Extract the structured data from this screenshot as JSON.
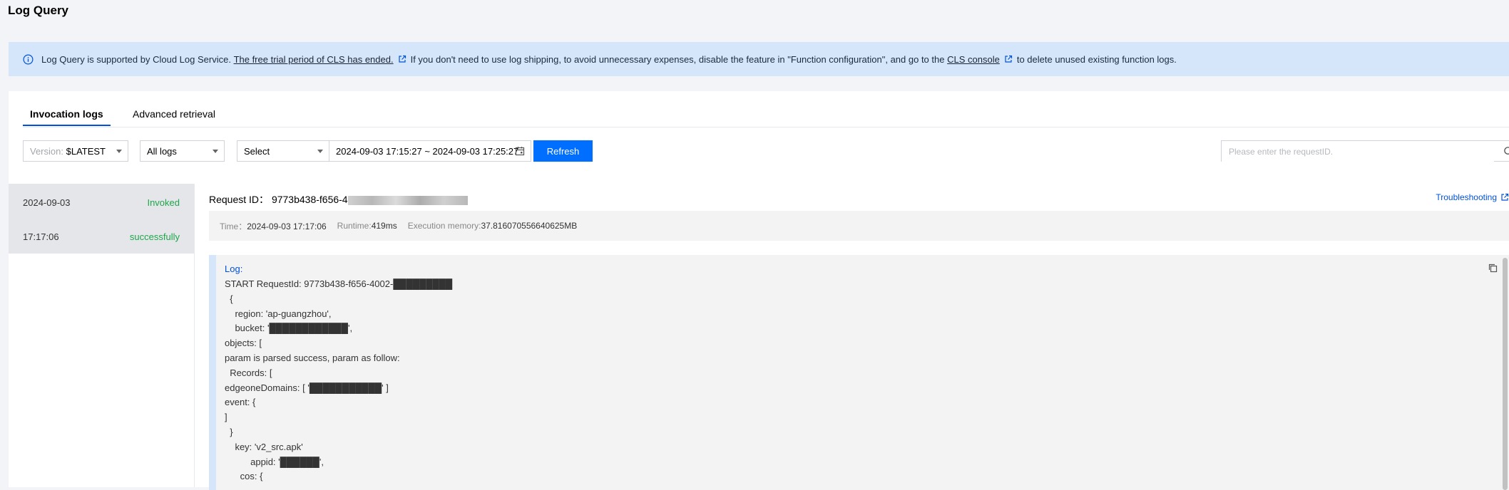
{
  "page": {
    "title": "Log Query"
  },
  "notice": {
    "text1": "Log Query is supported by Cloud Log Service.",
    "link1": "The free trial period of CLS has ended.",
    "text2": "If you don't need to use log shipping, to avoid unnecessary expenses, disable the feature in \"Function configuration\", and go to the",
    "link2": "CLS console",
    "text3": "to delete unused existing function logs.",
    "icon": "info-icon",
    "link_icon": "external-link-icon"
  },
  "tabs": [
    {
      "label": "Invocation logs",
      "active": true
    },
    {
      "label": "Advanced retrieval",
      "active": false
    }
  ],
  "toolbar": {
    "version_label": "Version:",
    "version_value": "$LATEST",
    "log_filter": "All logs",
    "time_select": "Select",
    "date_range": "2024-09-03 17:15:27 ~ 2024-09-03 17:25:27",
    "refresh_label": "Refresh",
    "search_placeholder": "Please enter the requestID."
  },
  "logs": [
    {
      "date": "2024-09-03",
      "time": "17:17:06",
      "status1": "Invoked",
      "status2": "successfully"
    }
  ],
  "detail": {
    "request_label": "Request ID：",
    "request_id": "9773b438-f656-4",
    "troubleshooting": "Troubleshooting",
    "time_label": "Time：",
    "time_value": "2024-09-03 17:17:06",
    "runtime_label": "Runtime:",
    "runtime_value": "419ms",
    "memory_label": "Execution memory:",
    "memory_value": "37.816070556640625MB",
    "log_label": "Log:",
    "log_text": "START RequestId: 9773b438-f656-4002-█████████\n  {\n    region: 'ap-guangzhou',\n    bucket: '████████████',\nobjects: [\nparam is parsed success, param as follow:\n  Records: [\nedgeoneDomains: [ '███████████' ]\nevent: {\n]\n  }\n    key: 'v2_src.apk'\n          appid: '██████',\n      cos: {"
  },
  "colors": {
    "accent": "#006eff",
    "success": "#1ea64a",
    "notice_bg": "#d5e6fb"
  }
}
